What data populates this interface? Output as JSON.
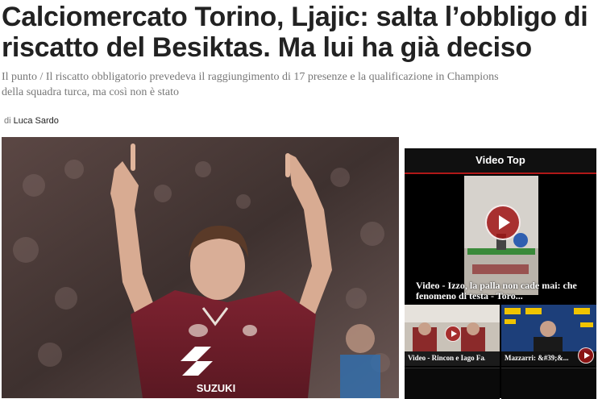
{
  "article": {
    "headline": "Calciomercato Torino, Ljajic: salta l’obbligo di riscatto del Besiktas. Ma lui ha già deciso",
    "summary": "Il punto / Il riscatto obbligatorio prevedeva il raggiungimento di 17 presenze e la qualificazione in Champions della squadra turca, ma così non è stato",
    "byline_prefix": "di",
    "author": "Luca Sardo"
  },
  "hero": {
    "jersey_text": "SUZUKI"
  },
  "sidebar": {
    "title": "Video Top",
    "accent": "#b01818",
    "main_video": {
      "title": "Video - Izzo, la palla non cade mai: che fenomeno di testa - Toro..."
    },
    "thumbnails": [
      {
        "label": "Video - Rincon e Iago Fa..."
      },
      {
        "label": "Mazzarri: &#39;&..."
      }
    ]
  }
}
